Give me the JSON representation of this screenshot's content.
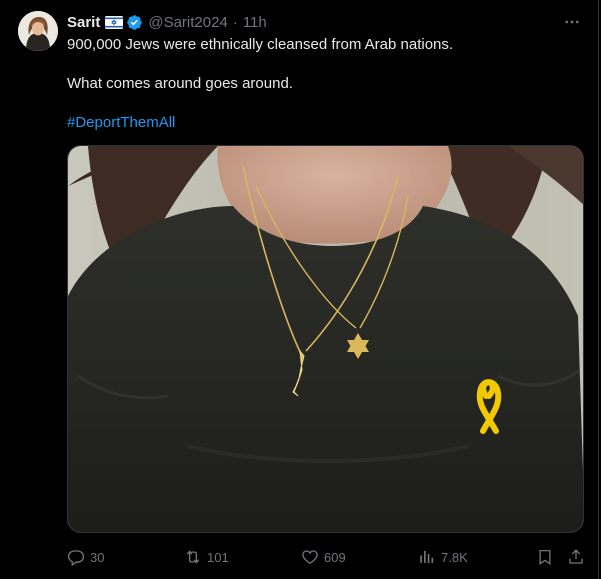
{
  "author": {
    "name": "Sarit",
    "handle": "@Sarit2024",
    "separator": "·",
    "time": "11h"
  },
  "tweet": {
    "line1": "900,000 Jews were ethnically cleansed from Arab nations.",
    "line2": "What comes around goes around.",
    "hashtag": "#DeportThemAll"
  },
  "actions": {
    "replies": "30",
    "retweets": "101",
    "likes": "609",
    "views": "7.8K"
  },
  "icons": {
    "more": "more-icon",
    "reply": "reply-icon",
    "retweet": "retweet-icon",
    "like": "heart-icon",
    "views": "views-icon",
    "bookmark": "bookmark-icon",
    "share": "share-icon",
    "verified": "verified-badge-icon",
    "flag": "israel-flag-icon"
  },
  "colors": {
    "background": "#000000",
    "text": "#e7e9ea",
    "secondary": "#71767b",
    "link": "#1d9bf0",
    "verified": "#1d9bf0"
  }
}
